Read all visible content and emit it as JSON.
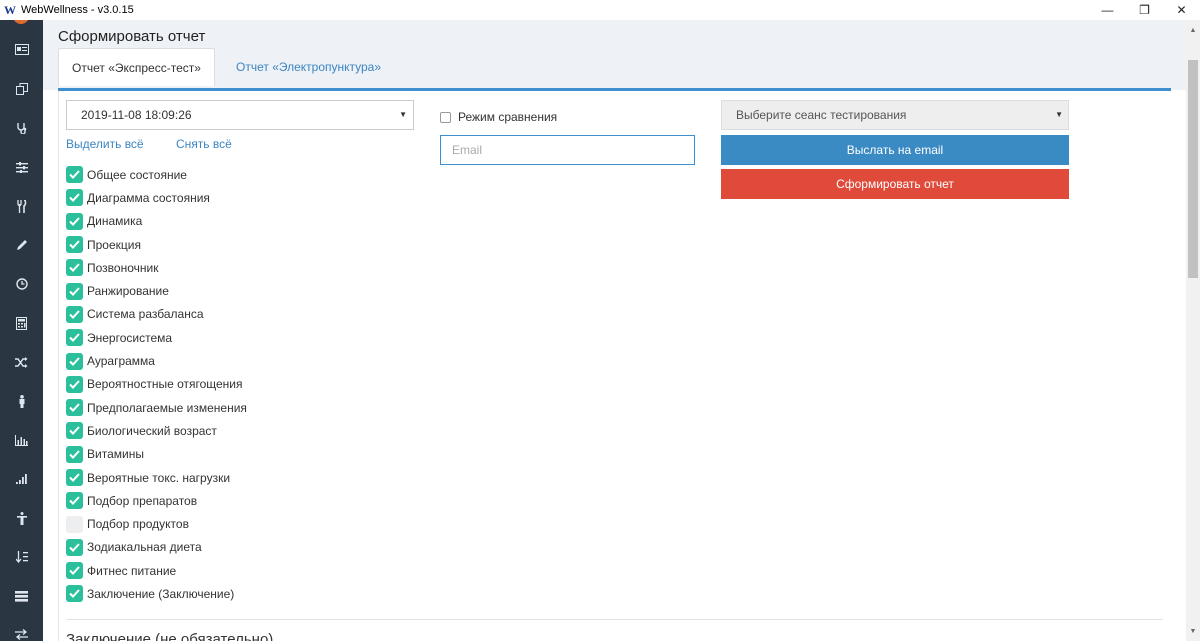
{
  "window": {
    "title": "WebWellness - v3.0.15",
    "minimize": "—",
    "restore": "❐",
    "close": "✕"
  },
  "sidebar": {
    "items": [
      {
        "icon": "id-card-icon"
      },
      {
        "icon": "copy-icon"
      },
      {
        "icon": "stethoscope-icon"
      },
      {
        "icon": "sliders-icon"
      },
      {
        "icon": "cutlery-icon"
      },
      {
        "icon": "pencil-icon"
      },
      {
        "icon": "clock-icon"
      },
      {
        "icon": "calculator-icon"
      },
      {
        "icon": "shuffle-icon"
      },
      {
        "icon": "person-icon"
      },
      {
        "icon": "bar-chart-icon"
      },
      {
        "icon": "signal-icon"
      },
      {
        "icon": "figure-icon"
      },
      {
        "icon": "sort-icon"
      },
      {
        "icon": "list-icon"
      },
      {
        "icon": "exchange-icon"
      }
    ]
  },
  "page": {
    "title": "Сформировать отчет"
  },
  "tabs": [
    {
      "label": "Отчет «Экспресс-тест»",
      "active": true
    },
    {
      "label": "Отчет «Электропунктура»",
      "active": false
    }
  ],
  "form": {
    "date_select": "2019-11-08 18:09:26",
    "select_all": "Выделить всё",
    "deselect_all": "Снять всё",
    "compare_mode": "Режим сравнения",
    "email_placeholder": "Email",
    "session_select": "Выберите сеанс тестирования",
    "send_email": "Выслать на email",
    "generate_report": "Сформировать отчет"
  },
  "options": [
    {
      "label": "Общее состояние",
      "checked": true
    },
    {
      "label": "Диаграмма состояния",
      "checked": true
    },
    {
      "label": "Динамика",
      "checked": true
    },
    {
      "label": "Проекция",
      "checked": true
    },
    {
      "label": "Позвоночник",
      "checked": true
    },
    {
      "label": "Ранжирование",
      "checked": true
    },
    {
      "label": "Система разбаланса",
      "checked": true
    },
    {
      "label": "Энергосистема",
      "checked": true
    },
    {
      "label": "Аураграмма",
      "checked": true
    },
    {
      "label": "Вероятностные отягощения",
      "checked": true
    },
    {
      "label": "Предполагаемые изменения",
      "checked": true
    },
    {
      "label": "Биологический возраст",
      "checked": true
    },
    {
      "label": "Витамины",
      "checked": true
    },
    {
      "label": "Вероятные токс. нагрузки",
      "checked": true
    },
    {
      "label": "Подбор препаратов",
      "checked": true
    },
    {
      "label": "Подбор продуктов",
      "checked": false
    },
    {
      "label": "Зодиакальная диета",
      "checked": true
    },
    {
      "label": "Фитнес питание",
      "checked": true
    },
    {
      "label": "Заключение (Заключение)",
      "checked": true
    }
  ],
  "section": {
    "heading": "Заключение (не обязательно)"
  },
  "colors": {
    "sidebar": "#2b3643",
    "checkbox": "#2bbf9c",
    "email_button": "#3a8ac4",
    "report_button": "#e04a3a",
    "link": "#3b85c3"
  }
}
